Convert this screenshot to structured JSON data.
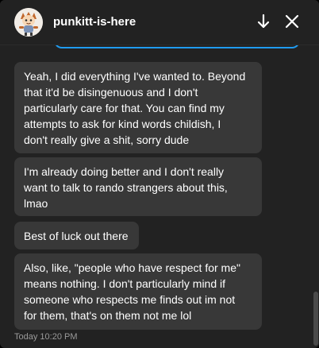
{
  "header": {
    "username": "punkitt-is-here",
    "avatar_icon": "cartoon-avatar-icon",
    "scroll_down_icon": "arrow-down-icon",
    "close_icon": "close-icon"
  },
  "messages": [
    {
      "text": "Yeah, I did everything I've wanted to. Beyond\nthat it'd be disingenuous and I don't\nparticularly care for that. You can find my\nattempts to ask for kind words childish, I\ndon't really give a shit, sorry dude"
    },
    {
      "text": "I'm already doing better and I don't really\nwant to talk to rando strangers about this,\nlmao"
    },
    {
      "text": "Best of luck out there"
    },
    {
      "text": "Also, like, \"people who have respect for me\"\nmeans nothing. I don't particularly mind if\nsomeone who respects me finds out im not\nfor them, that's on them not me lol"
    }
  ],
  "timestamp": "Today 10:20 PM",
  "colors": {
    "background": "#222222",
    "bubble": "#383838",
    "accent": "#1f9bf0",
    "text": "#ffffff",
    "muted": "#9a9a9a"
  }
}
